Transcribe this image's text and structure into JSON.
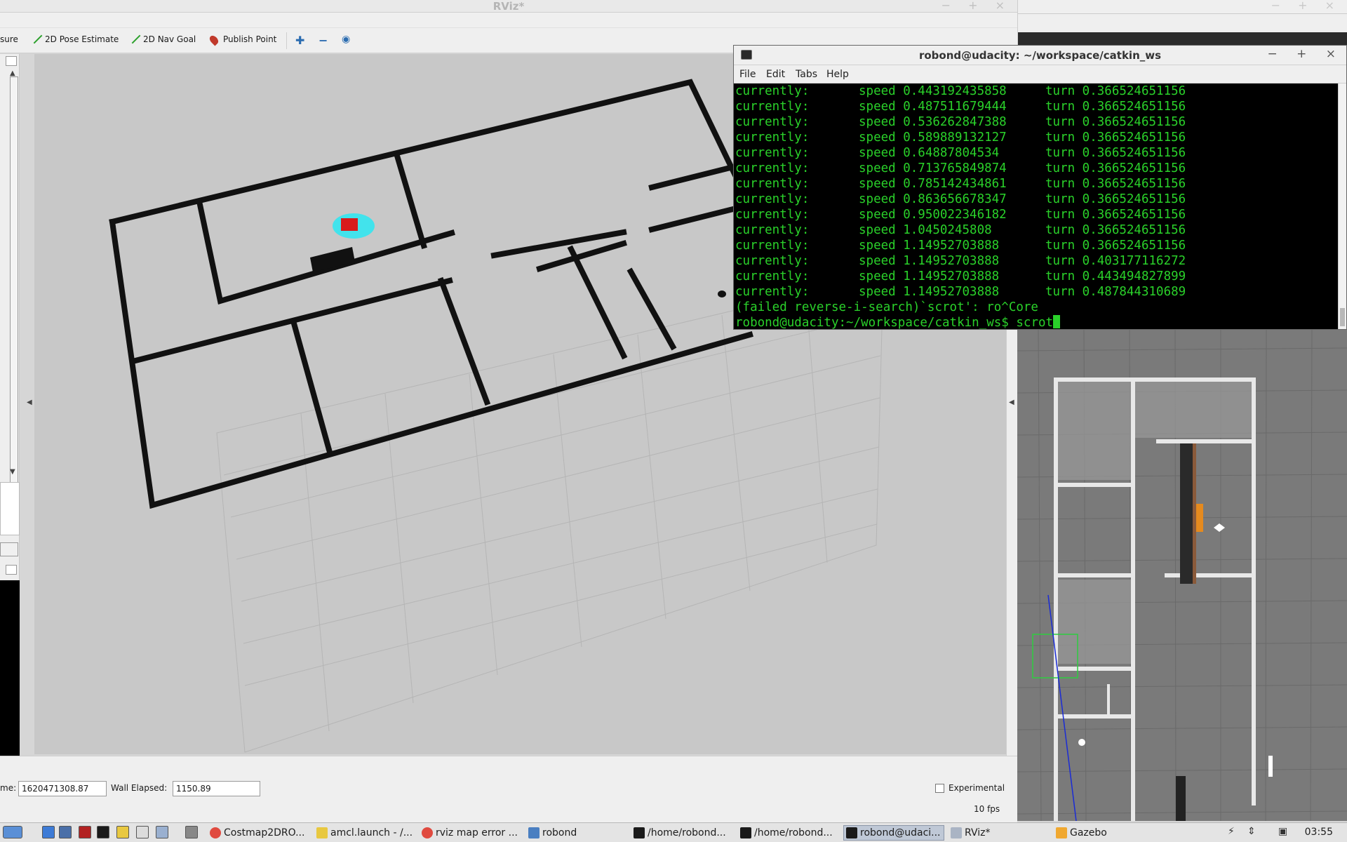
{
  "rviz": {
    "title": "RViz*",
    "window_buttons": "− + ×",
    "toolbar": {
      "measure_label": "sure",
      "pose_estimate_label": "2D Pose Estimate",
      "nav_goal_label": "2D Nav Goal",
      "publish_point_label": "Publish Point"
    },
    "status": {
      "time_label": "me:",
      "time_value": "1620471308.87",
      "wall_elapsed_label": "Wall Elapsed:",
      "wall_elapsed_value": "1150.89",
      "experimental_label": "Experimental",
      "fps": "10 fps"
    }
  },
  "terminal": {
    "title": "robond@udacity: ~/workspace/catkin_ws",
    "window_buttons": "− + ×",
    "menu": {
      "file": "File",
      "edit": "Edit",
      "tabs": "Tabs",
      "help": "Help"
    },
    "lines": [
      {
        "a": "currently:",
        "b": "speed 0.443192435858",
        "c": "turn 0.366524651156"
      },
      {
        "a": "currently:",
        "b": "speed 0.487511679444",
        "c": "turn 0.366524651156"
      },
      {
        "a": "currently:",
        "b": "speed 0.536262847388",
        "c": "turn 0.366524651156"
      },
      {
        "a": "currently:",
        "b": "speed 0.589889132127",
        "c": "turn 0.366524651156"
      },
      {
        "a": "currently:",
        "b": "speed 0.64887804534",
        "c": "turn 0.366524651156"
      },
      {
        "a": "currently:",
        "b": "speed 0.713765849874",
        "c": "turn 0.366524651156"
      },
      {
        "a": "currently:",
        "b": "speed 0.785142434861",
        "c": "turn 0.366524651156"
      },
      {
        "a": "currently:",
        "b": "speed 0.863656678347",
        "c": "turn 0.366524651156"
      },
      {
        "a": "currently:",
        "b": "speed 0.950022346182",
        "c": "turn 0.366524651156"
      },
      {
        "a": "currently:",
        "b": "speed 1.0450245808",
        "c": "turn 0.366524651156"
      },
      {
        "a": "currently:",
        "b": "speed 1.14952703888",
        "c": "turn 0.366524651156"
      },
      {
        "a": "currently:",
        "b": "speed 1.14952703888",
        "c": "turn 0.403177116272"
      },
      {
        "a": "currently:",
        "b": "speed 1.14952703888",
        "c": "turn 0.443494827899"
      },
      {
        "a": "currently:",
        "b": "speed 1.14952703888",
        "c": "turn 0.487844310689"
      }
    ],
    "search_line": "(failed reverse-i-search)`scrot': ro^Core",
    "prompt": "robond@udacity:~/workspace/catkin_ws$ ",
    "command": "scrot"
  },
  "gazebo": {
    "window_buttons": "− + ×"
  },
  "taskbar": {
    "tasks": [
      {
        "label": "Costmap2DRO...",
        "icon": "chrome-icon"
      },
      {
        "label": "amcl.launch - /...",
        "icon": "text-editor-icon"
      },
      {
        "label": "rviz map error ...",
        "icon": "chrome-icon"
      },
      {
        "label": "robond",
        "icon": "folder-icon"
      },
      {
        "label": "/home/robond...",
        "icon": "terminal-icon"
      },
      {
        "label": "/home/robond...",
        "icon": "terminal-icon"
      },
      {
        "label": "robond@udaci...",
        "icon": "terminal-icon"
      },
      {
        "label": "RViz*",
        "icon": "rviz-icon"
      },
      {
        "label": "Gazebo",
        "icon": "gazebo-icon"
      }
    ],
    "clock": "03:55"
  },
  "colors": {
    "terminal_text": "#2ad12a",
    "terminal_bg": "#000000",
    "map_wall": "#111111",
    "robot": "#d81b1b",
    "costmap": "#33e6f0"
  }
}
